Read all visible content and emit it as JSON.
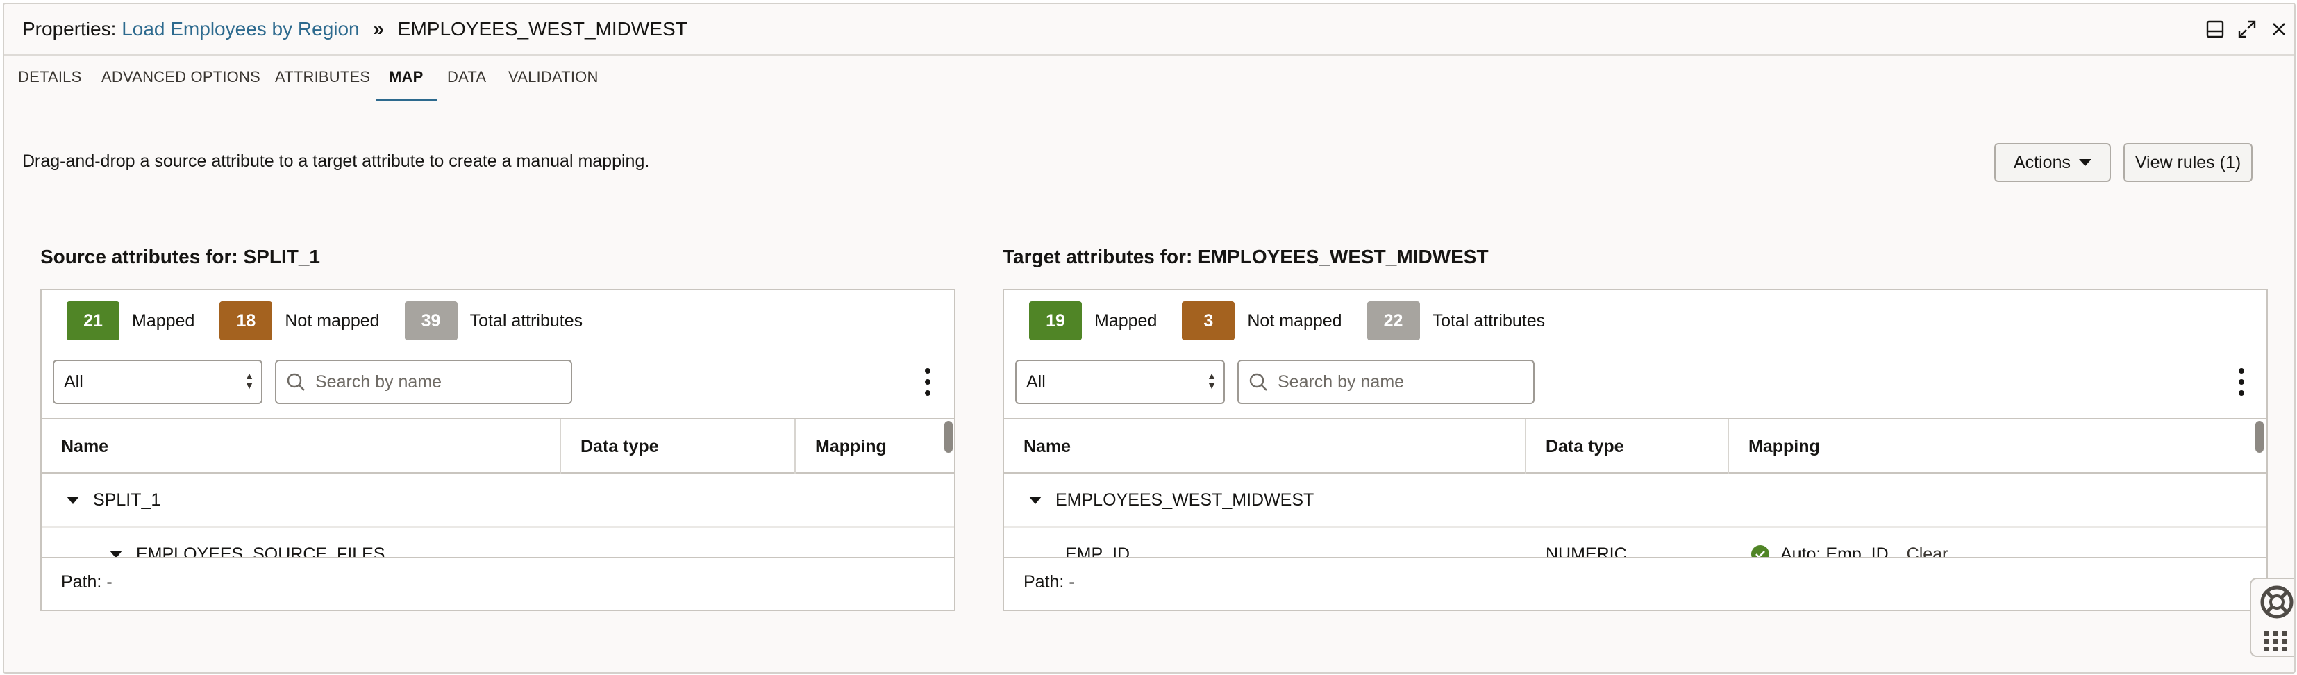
{
  "header": {
    "prefix": "Properties:",
    "link": "Load Employees by Region",
    "separator": "»",
    "target": "EMPLOYEES_WEST_MIDWEST",
    "icons": [
      "panel-icon",
      "expand-icon",
      "close-icon"
    ]
  },
  "tabs": [
    {
      "label": "DETAILS"
    },
    {
      "label": "ADVANCED OPTIONS"
    },
    {
      "label": "ATTRIBUTES"
    },
    {
      "label": "MAP",
      "active": true
    },
    {
      "label": "DATA"
    },
    {
      "label": "VALIDATION"
    }
  ],
  "main": {
    "description": "Drag-and-drop a source attribute to a target attribute to create a manual mapping.",
    "actions_label": "Actions",
    "view_rules_label": "View rules (1)"
  },
  "source": {
    "title": "Source attributes for: SPLIT_1",
    "mapped_count": "21",
    "mapped_label": "Mapped",
    "not_mapped_count": "18",
    "not_mapped_label": "Not mapped",
    "total_count": "39",
    "total_label": "Total attributes",
    "filter_value": "All",
    "search_placeholder": "Search by name",
    "columns": [
      "Name",
      "Data type",
      "Mapping"
    ],
    "rows": [
      {
        "name": "SPLIT_1"
      },
      {
        "name": "EMPLOYEES_SOURCE_FILES"
      }
    ],
    "path": "Path: -"
  },
  "target": {
    "title": "Target attributes for: EMPLOYEES_WEST_MIDWEST",
    "mapped_count": "19",
    "mapped_label": "Mapped",
    "not_mapped_count": "3",
    "not_mapped_label": "Not mapped",
    "total_count": "22",
    "total_label": "Total attributes",
    "filter_value": "All",
    "search_placeholder": "Search by name",
    "columns": [
      "Name",
      "Data type",
      "Mapping"
    ],
    "rows": [
      {
        "name": "EMPLOYEES_WEST_MIDWEST"
      },
      {
        "name": "EMP_ID",
        "type": "NUMERIC",
        "mapping": "Auto: Emp_ID",
        "action": "Clear"
      }
    ],
    "path": "Path: -"
  },
  "colors": {
    "link": "#2d6a8e",
    "mapped": "#508526",
    "not_mapped": "#a4621f",
    "total": "#a7a49f"
  }
}
